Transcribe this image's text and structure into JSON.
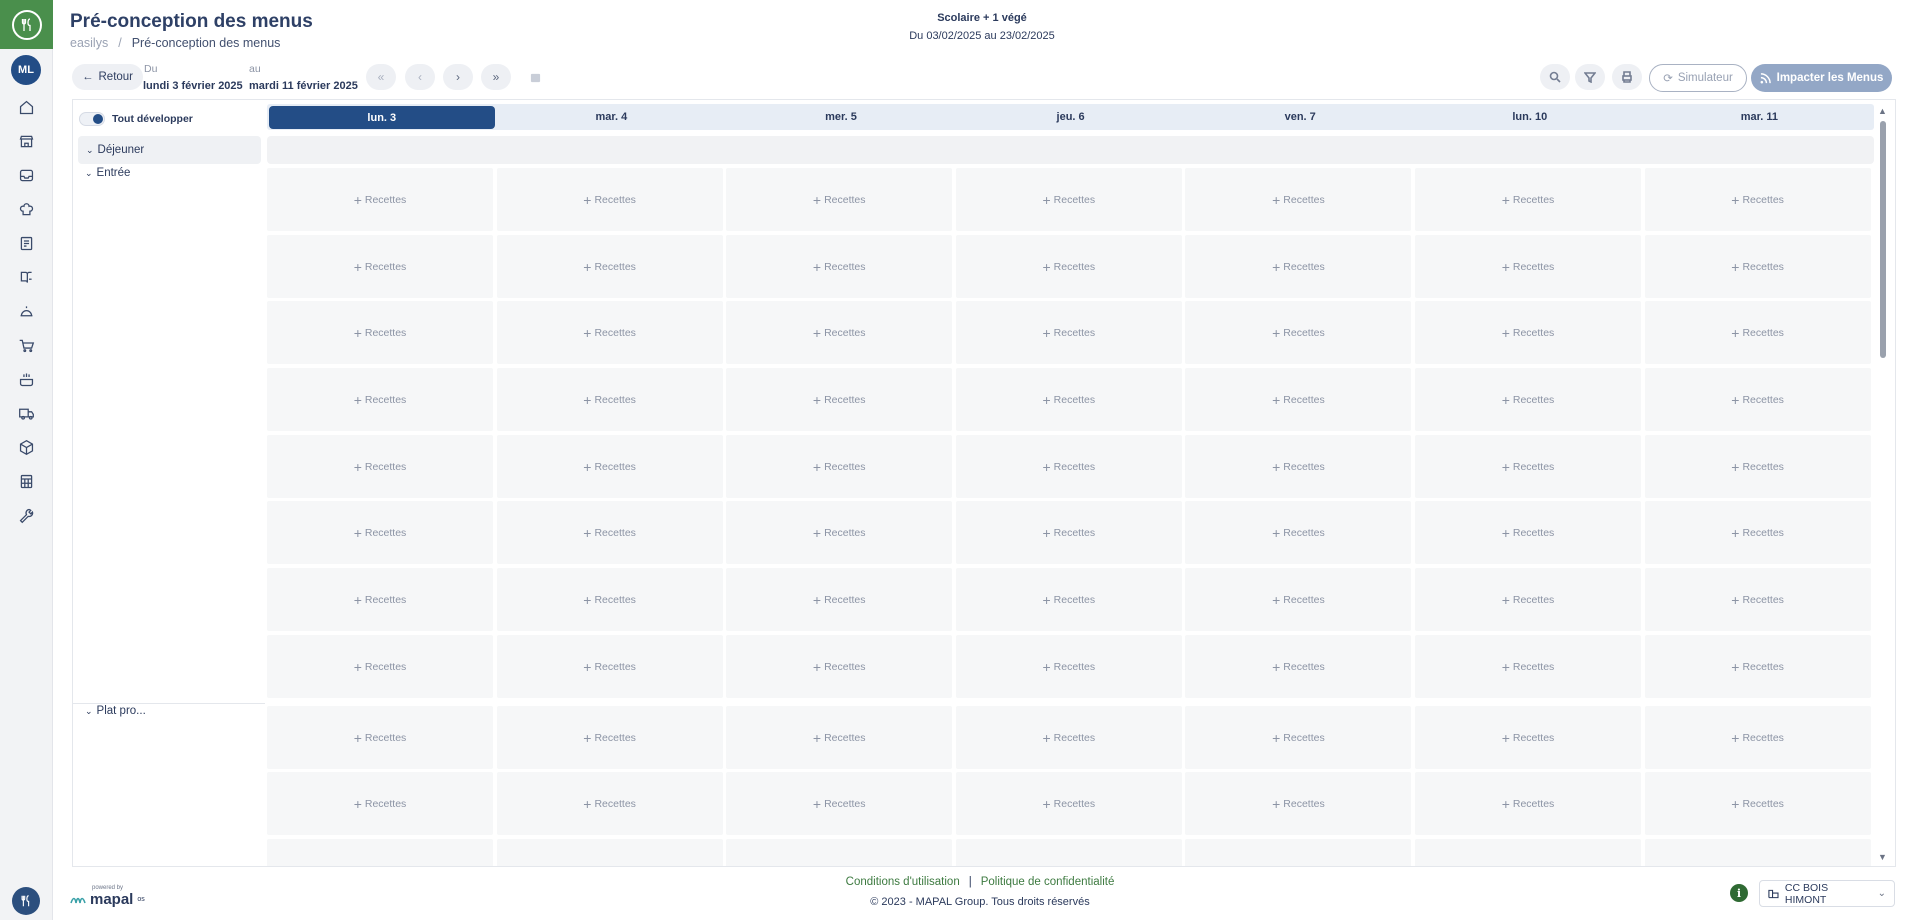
{
  "app": {
    "avatar_initials": "ML",
    "accent": "#234d86",
    "brand_green": "#4a8f4c"
  },
  "header": {
    "title": "Pré-conception des menus",
    "breadcrumb": [
      "easilys",
      "Pré-conception des menus"
    ],
    "menu_name": "Scolaire + 1 végé",
    "period": "Du 03/02/2025 au 23/02/2025"
  },
  "toolbar": {
    "back_label": "Retour",
    "from_label": "Du",
    "from_value": "lundi 3 février 2025",
    "to_label": "au",
    "to_value": "mardi 11 février 2025",
    "simulator_label": "Simulateur",
    "impact_label": "Impacter les Menus"
  },
  "grid": {
    "expand_all_label": "Tout développer",
    "meal_label": "Déjeuner",
    "categories": [
      "Entrée",
      "Plat pro..."
    ],
    "days": [
      "lun. 3",
      "mar. 4",
      "mer. 5",
      "jeu. 6",
      "ven. 7",
      "lun. 10",
      "mar. 11"
    ],
    "active_day_index": 0,
    "cell_label": "Recettes"
  },
  "footer": {
    "powered_by": "powered by",
    "brand": "mapal",
    "brand_suffix": "os",
    "terms_label": "Conditions d'utilisation",
    "separator": "|",
    "privacy_label": "Politique de confidentialité",
    "copyright": "© 2023 - MAPAL Group. Tous droits réservés",
    "site_name": "CC BOIS HIMONT"
  },
  "sidebar": {
    "icons": [
      "home-icon",
      "store-icon",
      "inbox-icon",
      "chef-hat-icon",
      "recipe-card-icon",
      "book-icon",
      "cloche-icon",
      "cart-icon",
      "cooking-pot-icon",
      "delivery-truck-icon",
      "package-icon",
      "calculator-icon",
      "wrench-icon"
    ]
  }
}
